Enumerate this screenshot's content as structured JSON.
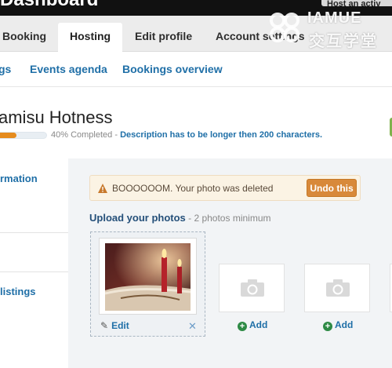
{
  "topbar": {
    "app_title": "Dashboard",
    "host_button": "Host an activ"
  },
  "tabs": [
    {
      "label": "Booking"
    },
    {
      "label": "Hosting",
      "active": true
    },
    {
      "label": "Edit profile"
    },
    {
      "label": "Account settings"
    }
  ],
  "subnav": [
    {
      "label": "gs"
    },
    {
      "label": "Events agenda"
    },
    {
      "label": "Bookings overview"
    }
  ],
  "listing": {
    "title": "amisu Hotness",
    "progress_percent": 40,
    "progress_label": "40% Completed -",
    "hint": "Description has to be longer then 200 characters."
  },
  "sidebar": {
    "items": [
      {
        "label": "rmation"
      },
      {
        "label": "listings"
      }
    ]
  },
  "alert": {
    "message": "BOOOOOOM. Your photo was deleted",
    "undo_label": "Undo this"
  },
  "upload": {
    "heading": "Upload your photos",
    "subheading": " - 2 photos minimum",
    "edit_label": "Edit",
    "add_label": "Add"
  },
  "watermark": {
    "line1": "IAMUE",
    "line2": "交互学堂"
  },
  "colors": {
    "link": "#1f6fa7",
    "accent_orange": "#e58b1d",
    "undo_button": "#d8893a",
    "add_plus": "#2e8a45",
    "topbar": "#111111"
  },
  "icons": [
    "warning-icon",
    "pencil-icon",
    "close-icon",
    "camera-icon",
    "plus-icon"
  ]
}
